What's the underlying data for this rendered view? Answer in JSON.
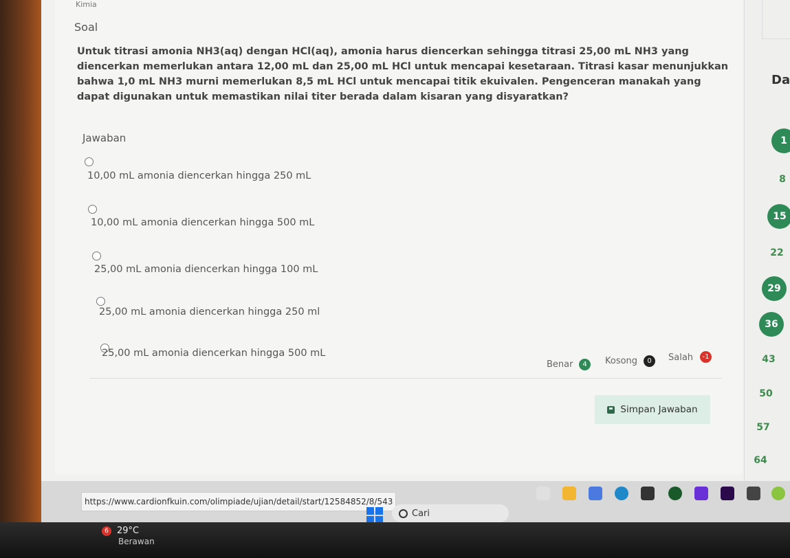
{
  "header": {
    "subject_partial": "Kimia",
    "section_title": "Soal"
  },
  "question": {
    "text": "Untuk titrasi amonia NH3(aq) dengan HCl(aq), amonia harus diencerkan sehingga titrasi 25,00 mL NH3 yang diencerkan memerlukan antara 12,00 mL dan 25,00 mL HCl untuk mencapai kesetaraan. Titrasi kasar menunjukkan bahwa 1,0 mL NH3 murni memerlukan 8,5 mL HCl untuk mencapai titik ekuivalen. Pengenceran manakah yang dapat digunakan untuk memastikan nilai titer berada dalam kisaran yang disyaratkan?"
  },
  "answer": {
    "label": "Jawaban",
    "options": [
      "10,00 mL amonia diencerkan hingga 250 mL",
      "10,00 mL amonia diencerkan hingga 500 mL",
      "25,00 mL amonia diencerkan hingga 100 mL",
      "25,00 mL amonia diencerkan hingga 250 ml",
      "25,00 mL amonia diencerkan hingga 500 mL"
    ]
  },
  "stats": {
    "benar_label": "Benar",
    "benar_value": "4",
    "kosong_label": "Kosong",
    "kosong_value": "0",
    "salah_label": "Salah",
    "salah_value": "-1"
  },
  "save_button": {
    "label": "Simpan Jawaban"
  },
  "side_panel": {
    "heading": "Da",
    "numbers": [
      "1",
      "8",
      "15",
      "22",
      "29",
      "36",
      "43",
      "50",
      "57",
      "64"
    ]
  },
  "browser": {
    "status_url": "https://www.cardionfkuin.com/olimpiade/ujian/detail/start/12584852/8/543"
  },
  "taskbar": {
    "search_label": "Cari",
    "weather_badge": "6",
    "weather_temp": "29°C",
    "weather_desc": "Berawan"
  },
  "colors": {
    "accent_green": "#2e8b57",
    "salah_red": "#d9342b",
    "button_bg": "#ddeee6"
  }
}
